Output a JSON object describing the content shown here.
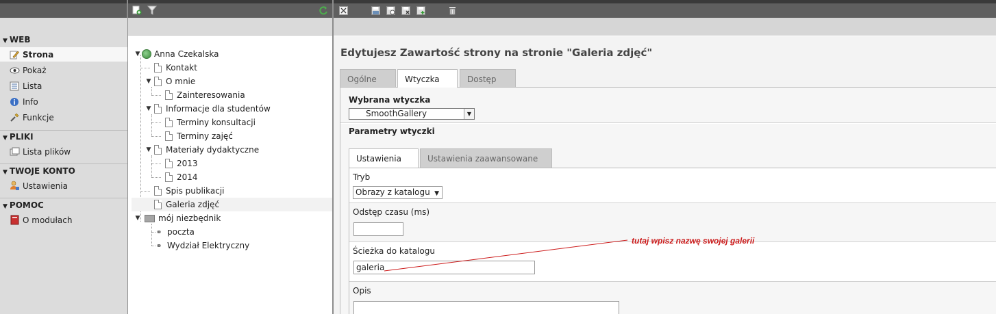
{
  "toolbar": {
    "left_icons": [
      "new-page-icon",
      "filter-icon",
      "refresh-icon"
    ],
    "right_icons": [
      "close-icon",
      "save-icon",
      "save-view-icon",
      "save-close-icon",
      "save-new-icon",
      "delete-icon"
    ]
  },
  "menu": {
    "sections": [
      {
        "label": "WEB",
        "items": [
          {
            "label": "Strona",
            "icon": "edit-page-icon",
            "active": true
          },
          {
            "label": "Pokaż",
            "icon": "eye-icon"
          },
          {
            "label": "Lista",
            "icon": "list-icon"
          },
          {
            "label": "Info",
            "icon": "info-icon"
          },
          {
            "label": "Funkcje",
            "icon": "wrench-icon"
          }
        ]
      },
      {
        "label": "PLIKI",
        "items": [
          {
            "label": "Lista plików",
            "icon": "file-list-icon"
          }
        ]
      },
      {
        "label": "TWOJE KONTO",
        "items": [
          {
            "label": "Ustawienia",
            "icon": "user-settings-icon"
          }
        ]
      },
      {
        "label": "POMOC",
        "items": [
          {
            "label": "O modułach",
            "icon": "book-icon"
          }
        ]
      }
    ]
  },
  "tree": [
    {
      "label": "Anna Czekalska"
    },
    {
      "label": "Kontakt"
    },
    {
      "label": "O mnie"
    },
    {
      "label": "Zainteresowania"
    },
    {
      "label": "Informacje dla studentów"
    },
    {
      "label": "Terminy konsultacji"
    },
    {
      "label": "Terminy zajęć"
    },
    {
      "label": "Materiały dydaktyczne"
    },
    {
      "label": "2013"
    },
    {
      "label": "2014"
    },
    {
      "label": "Spis publikacji"
    },
    {
      "label": "Galeria zdjęć"
    },
    {
      "label": "mój niezbędnik"
    },
    {
      "label": "poczta"
    },
    {
      "label": "Wydział Elektryczny"
    }
  ],
  "content": {
    "title": "Edytujesz Zawartość strony na stronie \"Galeria zdjęć\"",
    "tabs": [
      "Ogólne",
      "Wtyczka",
      "Dostęp"
    ],
    "active_tab": "Wtyczka",
    "plugin_label": "Wybrana wtyczka",
    "plugin_value": "SmoothGallery",
    "params_label": "Parametry wtyczki",
    "subtabs": [
      "Ustawienia",
      "Ustawienia zaawansowane"
    ],
    "fields": {
      "mode_label": "Tryb",
      "mode_value": "Obrazy z katalogu",
      "interval_label": "Odstęp czasu (ms)",
      "interval_value": "",
      "path_label": "Ścieżka do katalogu",
      "path_value": "galeria",
      "desc_label": "Opis",
      "desc_value": ""
    },
    "annotation": "tutaj wpisz nazwę swojej galerii"
  },
  "colors": {
    "annotation": "#cc1a1a",
    "topbar": "#5f5f5f",
    "menu_bg": "#dcdcdc"
  }
}
